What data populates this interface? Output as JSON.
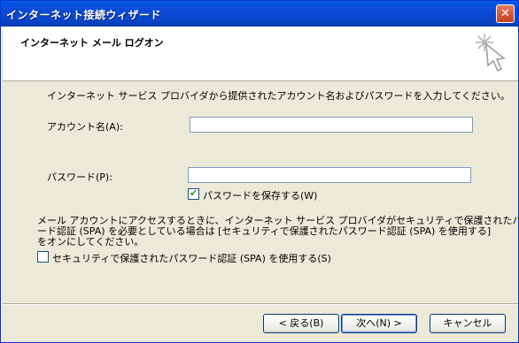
{
  "window": {
    "title": "インターネット接続ウィザード",
    "close_glyph": "✕"
  },
  "header": {
    "title": "インターネット メール ログオン",
    "icon": "wizard-sparkle-icon"
  },
  "form": {
    "intro": "インターネット サービス プロバイダから提供されたアカウント名およびパスワードを入力してください。",
    "account_label": "アカウント名(A):",
    "account_value": "",
    "password_label": "パスワード(P):",
    "password_value": "",
    "save_password_label": "パスワードを保存する(W)",
    "save_password_checked": true,
    "spa_note_1": "メール アカウントにアクセスするときに、インターネット サービス プロバイダがセキュリティで保護されたパスワ",
    "spa_note_2": "ード認証 (SPA) を必要としている場合は [セキュリティで保護されたパスワード認証 (SPA) を使用する]",
    "spa_note_3": "をオンにしてください。",
    "spa_label": "セキュリティで保護されたパスワード認証 (SPA) を使用する(S)",
    "spa_checked": false
  },
  "buttons": {
    "back": "< 戻る(B)",
    "next": "次へ(N) >",
    "cancel": "キャンセル"
  }
}
